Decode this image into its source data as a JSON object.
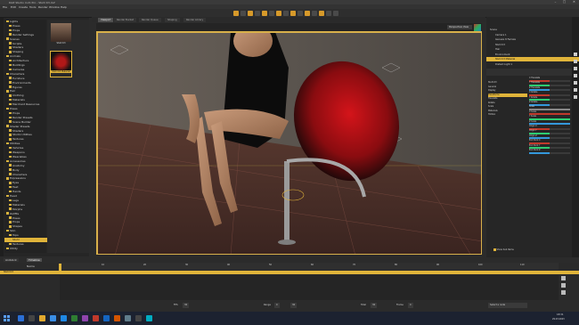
{
  "window": {
    "title": "DAZ Studio 4.21 Pro - Stuhl K3.duf",
    "controls": [
      "–",
      "□",
      "✕"
    ]
  },
  "menu": [
    "File",
    "Edit",
    "Create",
    "Tools",
    "Render",
    "Window",
    "Help"
  ],
  "viewport_tabs": [
    "Viewport",
    "Render Bucket",
    "Render Queue",
    "Shaping",
    "Render Library"
  ],
  "viewport": {
    "camera_label": "Perspective View"
  },
  "left_panel": {
    "tree": [
      "Lights",
      "Poses",
      "Props",
      "Render Settings",
      "Scenes",
      "Scripts",
      "Shaders",
      "Shaping",
      "Animals",
      "Architecture",
      "Buildings",
      "Cameras",
      "Characters",
      "Furniture",
      "Environments",
      "Figures",
      "Hair",
      "Clothing",
      "Materials",
      "Merchant Resources",
      "Poses",
      "Props",
      "Render Presets",
      "Scene Builder",
      "Shader Presets",
      "Shaders",
      "Studio Utilities",
      "Textures",
      "Utilities",
      "Vehicles",
      "Weapons",
      "Wearables",
      "Accessories",
      "Anatomy",
      "Body",
      "Characters",
      "Expressions",
      "Eyes",
      "Feet",
      "Hands",
      "Head",
      "Legs",
      "Materials",
      "Morphs",
      "Outfits",
      "Poses",
      "Props",
      "Shapes",
      "Skin",
      "Tops",
      "Stuhl",
      "Textures",
      "Utility"
    ],
    "tree_selected_index": 50,
    "thumbnails": [
      {
        "caption": "Stuhl K3"
      },
      {
        "caption": "Stuhl K3 Material"
      }
    ]
  },
  "scene_panel": {
    "rows": [
      "Scene",
      "Camera 1",
      "Genesis 8 Female",
      "Stuhl K3",
      "Hair",
      "Environment",
      "Stuhl K3 Material",
      "Distant Light 1"
    ],
    "selected_index": 6
  },
  "parameters": {
    "tree": [
      "Stuhl K3",
      "General",
      "Display",
      "Transforms",
      "Translate",
      "Rotate",
      "Scale",
      "Materials",
      "Hidden"
    ],
    "selected_index": 3,
    "rows": [
      {
        "label": "X Translate",
        "color": "#c0392b",
        "value": 0.5
      },
      {
        "label": "Y Translate",
        "color": "#2ecc71",
        "value": 0.5
      },
      {
        "label": "Z Translate",
        "color": "#3498db",
        "value": 0.5
      },
      {
        "label": "X Rotate",
        "color": "#c0392b",
        "value": 0.5
      },
      {
        "label": "Y Rotate",
        "color": "#2ecc71",
        "value": 0.5
      },
      {
        "label": "Z Rotate",
        "color": "#3498db",
        "value": 0.5
      },
      {
        "label": "Scale",
        "color": "#888888",
        "value": 1.0
      },
      {
        "label": "X Scale",
        "color": "#c0392b",
        "value": 1.0
      },
      {
        "label": "Y Scale",
        "color": "#2ecc71",
        "value": 1.0
      },
      {
        "label": "Z Scale",
        "color": "#3498db",
        "value": 1.0
      },
      {
        "label": "Origin X",
        "color": "#c0392b",
        "value": 0.5
      },
      {
        "label": "Origin Y",
        "color": "#2ecc71",
        "value": 0.5
      },
      {
        "label": "Origin Z",
        "color": "#3498db",
        "value": 0.5
      },
      {
        "label": "End Point X",
        "color": "#c0392b",
        "value": 0.5
      },
      {
        "label": "End Point Y",
        "color": "#2ecc71",
        "value": 0.5
      },
      {
        "label": "End Point Z",
        "color": "#3498db",
        "value": 0.5
      }
    ],
    "footer": "Show Sub Items"
  },
  "timeline": {
    "tabs": [
      "Aniblock",
      "Timeline"
    ],
    "active_tab": 1,
    "header": "Name",
    "track": "Stuhl K3",
    "ruler": [
      "0",
      "10",
      "20",
      "30",
      "40",
      "50",
      "60",
      "70",
      "80",
      "90",
      "100",
      "110"
    ],
    "controls": {
      "fps_label": "FPS",
      "fps": "30",
      "range_label": "Range",
      "range_start": "0",
      "range_end": "30",
      "total_label": "Total",
      "total": "30",
      "frame_label": "Frame",
      "frame": "0"
    },
    "right_label": "Select a node"
  },
  "taskbar": {
    "time": "18:31",
    "date": "29.03.2023",
    "app_colors": [
      "#2b6fd6",
      "#444",
      "#e0a82e",
      "#3a8ee6",
      "#1e88e5",
      "#2e7d32",
      "#8e44ad",
      "#c0392b",
      "#1565c0",
      "#d35400",
      "#607d8b",
      "#444",
      "#00acc1"
    ]
  },
  "accent": "#e0b43a"
}
